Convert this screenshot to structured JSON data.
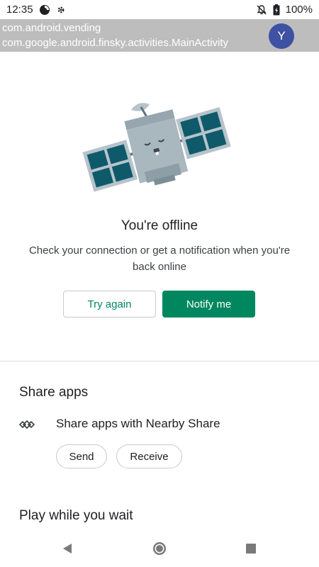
{
  "status_bar": {
    "time": "12:35",
    "battery": "100%",
    "icons": [
      "data-saver-icon",
      "settings-notification-icon",
      "notifications-off-icon",
      "battery-icon"
    ]
  },
  "debug_overlay": {
    "package": "com.android.vending",
    "activity": "com.google.android.finsky.activities.MainActivity",
    "avatar_letter": "Y"
  },
  "offline": {
    "illustration": "sleeping-satellite-illustration",
    "title": "You're offline",
    "description": "Check your connection or get a notification when you're back online",
    "try_again_label": "Try again",
    "notify_me_label": "Notify me"
  },
  "share_apps": {
    "title": "Share apps",
    "nearby_icon": "nearby-share-icon",
    "nearby_label": "Share apps with Nearby Share",
    "send_label": "Send",
    "receive_label": "Receive"
  },
  "play_while_wait": {
    "title": "Play while you wait"
  },
  "nav_bar": {
    "icons": [
      "back-icon",
      "home-icon",
      "recents-icon"
    ]
  },
  "colors": {
    "accent": "#01875f",
    "overlay": "#bdbdbd",
    "avatar": "#3f51a3"
  }
}
